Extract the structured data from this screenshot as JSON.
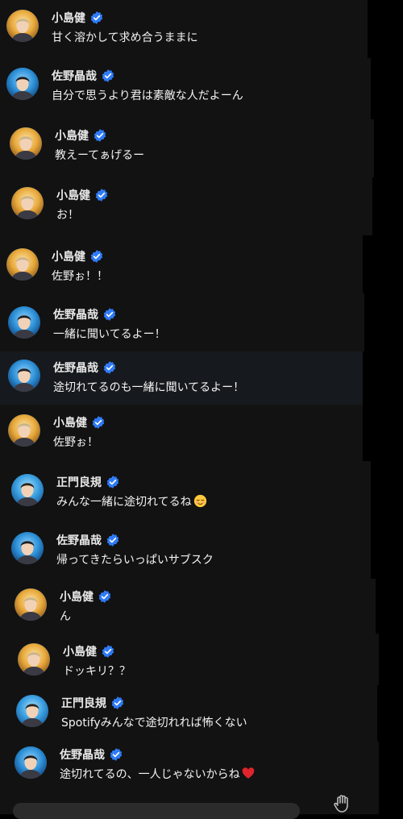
{
  "colors": {
    "background": "#000000",
    "panel": "#121212",
    "verified_blue": "#2f7bf6",
    "name_text": "#e9e9e9",
    "message_text": "#f3f3f3"
  },
  "messages": [
    {
      "user": "小島健",
      "avatar": "avatar-kojima",
      "text": "甘く溶かして求め合うままに"
    },
    {
      "user": "佐野晶哉",
      "avatar": "avatar-sano",
      "text": "自分で思うより君は素敵な人だよーん"
    },
    {
      "user": "小島健",
      "avatar": "avatar-kojima",
      "text": "教えーてぁげるー"
    },
    {
      "user": "小島健",
      "avatar": "avatar-kojima",
      "text": "お！"
    },
    {
      "user": "小島健",
      "avatar": "avatar-kojima",
      "text": "佐野ぉ！！"
    },
    {
      "user": "佐野晶哉",
      "avatar": "avatar-sano",
      "text": "一緒に聞いてるよー！"
    },
    {
      "user": "佐野晶哉",
      "avatar": "avatar-sano",
      "text": "途切れてるのも一緒に聞いてるよー！"
    },
    {
      "user": "小島健",
      "avatar": "avatar-kojima",
      "text": "佐野ぉ！"
    },
    {
      "user": "正門良規",
      "avatar": "avatar-masakado",
      "text": "みんな一緒に途切れてるね",
      "emoji": "relieved-face-icon"
    },
    {
      "user": "佐野晶哉",
      "avatar": "avatar-sano",
      "text": "帰ってきたらいっぱいサブスク"
    },
    {
      "user": "小島健",
      "avatar": "avatar-kojima",
      "text": "ん"
    },
    {
      "user": "小島健",
      "avatar": "avatar-kojima",
      "text": "ドッキリ？？"
    },
    {
      "user": "正門良規",
      "avatar": "avatar-masakado",
      "text": "Spotifyみんなで途切れれば怖くない"
    },
    {
      "user": "佐野晶哉",
      "avatar": "avatar-sano",
      "text": "途切れてるの、一人じゃないからね",
      "emoji": "red-heart-icon"
    }
  ],
  "footer": {
    "icon": "raised-hand-icon"
  }
}
